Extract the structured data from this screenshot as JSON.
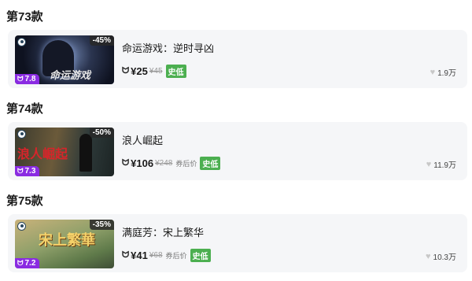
{
  "games": [
    {
      "section": "第73款",
      "name": "命运游戏：逆时寻凶",
      "discount": "-45%",
      "rating": "7.8",
      "cover_text": "命运游戏",
      "currency": "¥",
      "price": "25",
      "original_price": "¥45",
      "after_label": "",
      "badge": "史低",
      "likes": "1.9万"
    },
    {
      "section": "第74款",
      "name": "浪人崛起",
      "discount": "-50%",
      "rating": "7.3",
      "cover_text": "浪人崛起",
      "currency": "¥",
      "price": "106",
      "original_price": "¥248",
      "after_label": "券后价",
      "badge": "史低",
      "likes": "11.9万"
    },
    {
      "section": "第75款",
      "name": "满庭芳：宋上繁华",
      "discount": "-35%",
      "rating": "7.2",
      "cover_text": "宋上繁華",
      "currency": "¥",
      "price": "41",
      "original_price": "¥68",
      "after_label": "券后价",
      "badge": "史低",
      "likes": "10.3万"
    }
  ],
  "icons": {
    "platform": "steam-icon",
    "rating": "heybox-icon",
    "like": "heart-icon"
  },
  "colors": {
    "rating_badge": "#8a2be2",
    "lowest_badge": "#4caf50"
  }
}
